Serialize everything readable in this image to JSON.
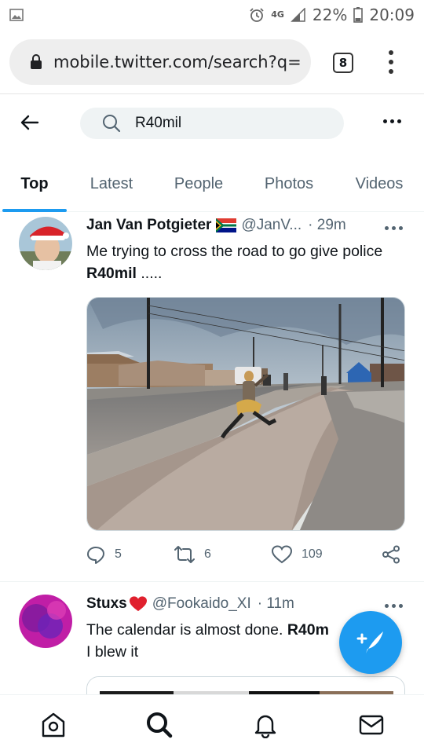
{
  "status_bar": {
    "network": "4G",
    "battery": "22%",
    "time": "20:09"
  },
  "browser": {
    "url": "mobile.twitter.com/search?q=",
    "tab_count": "8"
  },
  "search": {
    "query": "R40mil"
  },
  "tabs": [
    {
      "label": "Top",
      "active": true
    },
    {
      "label": "Latest",
      "active": false
    },
    {
      "label": "People",
      "active": false
    },
    {
      "label": "Photos",
      "active": false
    },
    {
      "label": "Videos",
      "active": false
    }
  ],
  "tweets": [
    {
      "name": "Jan Van Potgieter",
      "flag": "South Africa flag",
      "handle": "@JanV...",
      "time": "· 29m",
      "text_before": "Me trying to cross the road to go give police ",
      "text_bold": "R40mil",
      "text_after": " .....",
      "replies": "5",
      "retweets": "6",
      "likes": "109"
    },
    {
      "name": "Stuxs",
      "emoji": "❤️",
      "handle": "@Fookaido_XI",
      "time": "· 11m",
      "text_before": "The calendar is almost done. ",
      "text_bold": "R40m",
      "text_line2": "I blew it"
    }
  ],
  "colors": {
    "accent": "#1d9bf0",
    "text_primary": "#0f1419",
    "text_secondary": "#536471"
  },
  "icons": [
    "gallery-icon",
    "alarm-icon",
    "signal-icon",
    "battery-icon",
    "lock-icon",
    "back-arrow-icon",
    "search-icon",
    "more-icon",
    "reply-icon",
    "retweet-icon",
    "like-icon",
    "share-icon",
    "compose-icon",
    "home-icon",
    "explore-icon",
    "notifications-icon",
    "messages-icon"
  ]
}
